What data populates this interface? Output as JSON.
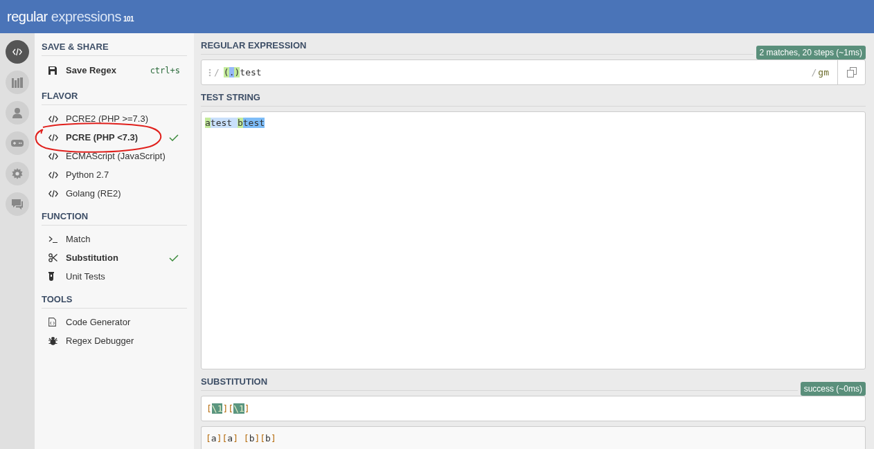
{
  "header": {
    "logo_main": "regular",
    "logo_accent": "expressions",
    "logo_version": "101"
  },
  "rail": [
    {
      "kind": "code",
      "selected": true
    },
    {
      "kind": "library",
      "selected": false
    },
    {
      "kind": "user",
      "selected": false
    },
    {
      "kind": "gamepad",
      "selected": false
    },
    {
      "kind": "settings",
      "selected": false
    },
    {
      "kind": "chat",
      "selected": false
    }
  ],
  "sidebar": {
    "save_share": {
      "title": "SAVE & SHARE",
      "item": {
        "kind": "floppy",
        "label": "Save Regex",
        "shortcut": "ctrl+s"
      }
    },
    "sections": [
      {
        "title": "FLAVOR",
        "items": [
          {
            "kind": "code",
            "label": "PCRE2 (PHP >=7.3)",
            "selected": false
          },
          {
            "kind": "code",
            "label": "PCRE (PHP <7.3)",
            "selected": true
          },
          {
            "kind": "code",
            "label": "ECMAScript (JavaScript)",
            "selected": false
          },
          {
            "kind": "code",
            "label": "Python 2.7",
            "selected": false
          },
          {
            "kind": "code",
            "label": "Golang (RE2)",
            "selected": false
          }
        ]
      },
      {
        "title": "FUNCTION",
        "items": [
          {
            "kind": "terminal",
            "label": "Match",
            "selected": false
          },
          {
            "kind": "scissors",
            "label": "Substitution",
            "selected": true
          },
          {
            "kind": "tube",
            "label": "Unit Tests",
            "selected": false
          }
        ]
      },
      {
        "title": "TOOLS",
        "items": [
          {
            "kind": "codefile",
            "label": "Code Generator",
            "selected": false
          },
          {
            "kind": "bug",
            "label": "Regex Debugger",
            "selected": false
          }
        ]
      }
    ],
    "annotation": {
      "kind": "hand-drawn-circle"
    }
  },
  "regex": {
    "title": "REGULAR EXPRESSION",
    "status": "2 matches, 20 steps (~1ms)",
    "delimiter_open": "/",
    "tokens": [
      {
        "text": "(",
        "kind": "group"
      },
      {
        "text": ".",
        "kind": "meta"
      },
      {
        "text": ")",
        "kind": "group"
      },
      {
        "text": "test",
        "kind": "plain"
      }
    ],
    "delimiter_close": "/",
    "flags": "gm"
  },
  "test_string": {
    "title": "TEST STRING",
    "tokens": [
      {
        "text": "a",
        "kind": "group"
      },
      {
        "text": "test ",
        "kind": "match"
      },
      {
        "text": "b",
        "kind": "group"
      },
      {
        "text": "test",
        "kind": "match_alt"
      }
    ]
  },
  "substitution": {
    "title": "SUBSTITUTION",
    "status": "success (~0ms)",
    "tokens": [
      {
        "text": "[",
        "kind": "literal"
      },
      {
        "text": "\\1",
        "kind": "ref"
      },
      {
        "text": "][",
        "kind": "literal"
      },
      {
        "text": "\\1",
        "kind": "ref"
      },
      {
        "text": "]",
        "kind": "literal"
      }
    ],
    "result": [
      {
        "text": "[",
        "kind": "literal"
      },
      {
        "text": "a",
        "kind": "plain"
      },
      {
        "text": "][",
        "kind": "literal"
      },
      {
        "text": "a",
        "kind": "plain"
      },
      {
        "text": "] [",
        "kind": "literal"
      },
      {
        "text": "b",
        "kind": "plain"
      },
      {
        "text": "][",
        "kind": "literal"
      },
      {
        "text": "b",
        "kind": "plain"
      },
      {
        "text": "]",
        "kind": "literal"
      }
    ]
  }
}
